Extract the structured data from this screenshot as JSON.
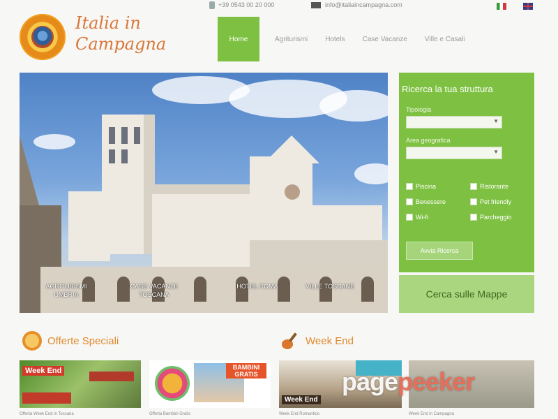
{
  "topbar": {
    "phone": "+39 0543 00 20 000",
    "email": "info@italiaincampagna.com",
    "languages": [
      "it",
      "en"
    ]
  },
  "logo": {
    "line1": "Italia in",
    "line2": "Campagna"
  },
  "nav": {
    "items": [
      {
        "label": "Home",
        "active": true
      },
      {
        "label": "Agriturismi"
      },
      {
        "label": "Hotels"
      },
      {
        "label": "Case Vacanze"
      },
      {
        "label": "Ville e Casali"
      }
    ]
  },
  "hero": {
    "captions": [
      {
        "text": "AGRITURISMI UMBRIA"
      },
      {
        "text": "CASE VACANZE TOSCANA"
      },
      {
        "text": "HOTEL ROMA"
      },
      {
        "text": "VILLE TOSCANE"
      }
    ]
  },
  "search": {
    "title": "Ricerca la tua struttura",
    "location_label": "Tipologia",
    "location_value": "",
    "area_label": "Area geografica",
    "area_value": "",
    "options": [
      {
        "label": "Piscina",
        "checked": false
      },
      {
        "label": "Ristorante",
        "checked": false
      },
      {
        "label": "Benessere",
        "checked": false
      },
      {
        "label": "Pet friendly",
        "checked": false
      },
      {
        "label": "Wi-fi",
        "checked": false
      },
      {
        "label": "Parcheggio",
        "checked": false
      }
    ],
    "submit_label": "Avvia Ricerca",
    "map_label": "Cerca sulle Mappe"
  },
  "sections": {
    "offers": {
      "title": "Offerte Speciali"
    },
    "weekend": {
      "title": "Week End"
    }
  },
  "thumbs": [
    {
      "overlay": "Week End",
      "caption": "Offerta Week End in Toscana"
    },
    {
      "overlay": "BAMBINI GRATIS",
      "caption": "Offerta Bambini Gratis"
    },
    {
      "overlay": "Week End",
      "caption": "Week End Romantico"
    },
    {
      "overlay": "",
      "caption": "Week End in Campagna"
    }
  ],
  "watermark": {
    "part1": "page",
    "part2": "peeker"
  },
  "colors": {
    "accent_green": "#7ec142",
    "accent_orange": "#e08a2e"
  }
}
